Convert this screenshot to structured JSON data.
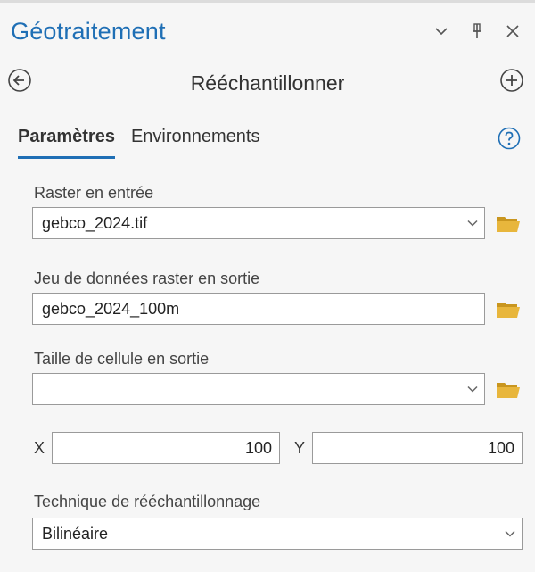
{
  "panel": {
    "title": "Géotraitement"
  },
  "tool": {
    "title": "Rééchantillonner"
  },
  "tabs": [
    {
      "label": "Paramètres",
      "active": true
    },
    {
      "label": "Environnements",
      "active": false
    }
  ],
  "params": {
    "input_raster": {
      "label": "Raster en entrée",
      "value": "gebco_2024.tif"
    },
    "output_raster": {
      "label": "Jeu de données raster en sortie",
      "value": "gebco_2024_100m"
    },
    "cell_size": {
      "label": "Taille de cellule en sortie",
      "value": ""
    },
    "x": {
      "label": "X",
      "value": "100"
    },
    "y": {
      "label": "Y",
      "value": "100"
    },
    "technique": {
      "label": "Technique de rééchantillonnage",
      "value": "Bilinéaire"
    }
  },
  "colors": {
    "accent": "#1f6fb5",
    "folder": "#e8b63c",
    "background": "#f6f6f6"
  },
  "icons": [
    "chevron-down-icon",
    "pin-icon",
    "close-icon",
    "back-arrow-icon",
    "add-icon",
    "help-icon",
    "folder-icon"
  ]
}
